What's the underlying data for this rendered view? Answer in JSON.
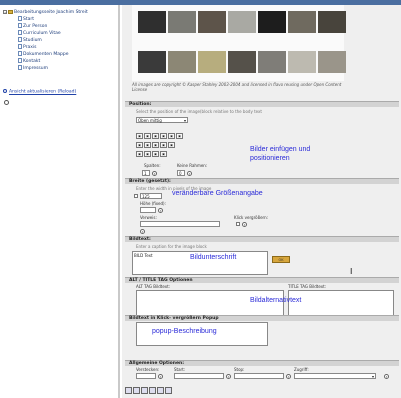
{
  "tree": {
    "items": [
      {
        "label": "Bearbeitungsseite Joachim Streit"
      },
      {
        "label": "Start"
      },
      {
        "label": "Zur Person"
      },
      {
        "label": "Curriculum Vitae"
      },
      {
        "label": "Studium"
      },
      {
        "label": "Praxis"
      },
      {
        "label": "Dokumenten Mappe"
      },
      {
        "label": "Kontakt"
      },
      {
        "label": "Impressum"
      }
    ],
    "refresh_label": "Ansicht aktualisieren (Reload)"
  },
  "gallery": {
    "copyright": "All images are copyright © Kasper Stahley 2003-2004 and licensed in flavo reusing under Open Content License"
  },
  "position": {
    "title": "Position:",
    "hint": "Select the position of the image(block relative to the body text",
    "select_value": "Oben mittig",
    "spalten_label": "Spalten:",
    "spalten_value": "1",
    "feine_label": "Keine Rahmen:",
    "feine_value": "0"
  },
  "breite": {
    "title": "Breite (gesetzt):",
    "hint": "Enter the width in pixels of the image",
    "width_value": "125",
    "hoehe_label": "Höhe (fixed):",
    "hoehe_value": "",
    "verweis_label": "Verweis:",
    "klick_label": "Klick vergrößern:"
  },
  "bildtext": {
    "title": "Bildtext:",
    "hint": "Enter a caption for the image block",
    "value": "BILD Text"
  },
  "alt": {
    "title": "ALT / TITLE TAG Optionen",
    "alt_label": "ALT TAG Bildtext:",
    "title_label": "TITLE TAG Bildtext:"
  },
  "popup": {
    "title": "Bildtext in Klick- vergrößern Popup"
  },
  "allgemein": {
    "title": "Allgemeine Optionen:",
    "fields": [
      "Verstecken:",
      "Start:",
      "Stop:",
      "Zugriff:"
    ]
  },
  "annotations": {
    "bilder": "Bilder einfügen und positionieren",
    "groesse": "veränderbare Größenangabe",
    "unterschrift": "Bildunterschrift",
    "alternativ": "Bildalternativtext",
    "popup": "popup-Beschreibung"
  },
  "colors": {
    "annotation": "#2b2bd8",
    "section": "#d3d3d3",
    "pane": "#efefef"
  }
}
